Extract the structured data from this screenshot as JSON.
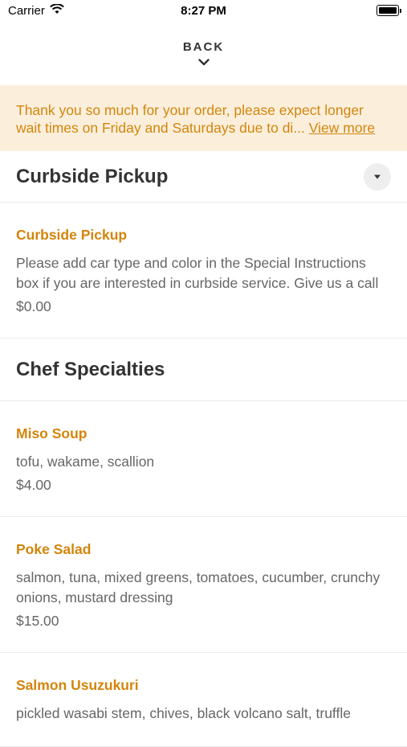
{
  "status_bar": {
    "carrier": "Carrier",
    "time": "8:27 PM"
  },
  "nav": {
    "back_label": "BACK"
  },
  "banner": {
    "text": "Thank you so much for your order, please expect longer wait times on Friday and Saturdays due to di...",
    "more_label": "View more"
  },
  "sections": [
    {
      "title": "Curbside Pickup",
      "items": [
        {
          "name": "Curbside Pickup",
          "description": "Please add car type and color in the Special Instructions box if you are interested in curbside service. Give us a call",
          "price": "$0.00"
        }
      ]
    },
    {
      "title": "Chef Specialties",
      "items": [
        {
          "name": "Miso Soup",
          "description": "tofu, wakame, scallion",
          "price": "$4.00"
        },
        {
          "name": "Poke Salad",
          "description": "salmon, tuna, mixed greens, tomatoes, cucumber, crunchy onions, mustard dressing",
          "price": "$15.00"
        },
        {
          "name": "Salmon Usuzukuri",
          "description": "pickled wasabi stem, chives, black volcano salt, truffle",
          "price": ""
        }
      ]
    }
  ],
  "colors": {
    "accent": "#d3850b",
    "banner_bg": "#fbefdc",
    "text": "#333333",
    "muted": "#666666"
  }
}
